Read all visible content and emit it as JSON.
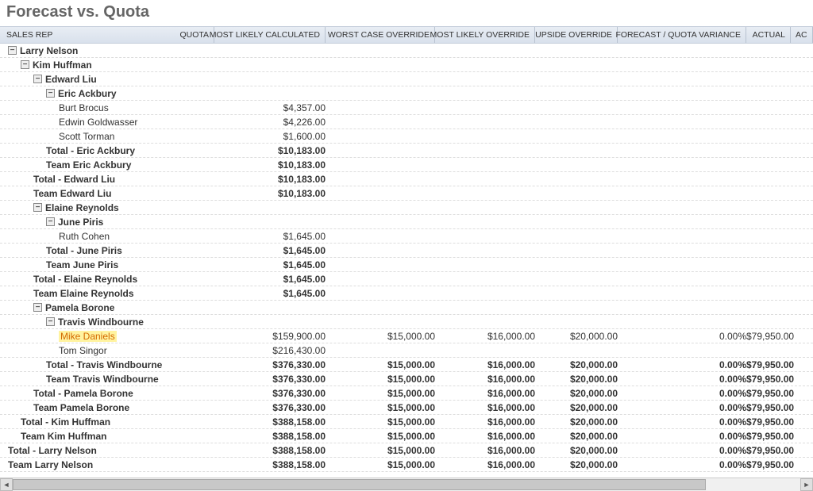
{
  "title": "Forecast vs. Quota",
  "headers": {
    "rep": "SALES REP",
    "quota": "QUOTA",
    "mlc": "MOST LIKELY CALCULATED",
    "wco": "WORST CASE OVERRIDE",
    "mlo": "MOST LIKELY OVERRIDE",
    "uo": "UPSIDE OVERRIDE",
    "fqv": "FORECAST / QUOTA VARIANCE",
    "actual": "ACTUAL",
    "last": "AC"
  },
  "rows": [
    {
      "indent": 0,
      "toggle": true,
      "bold": true,
      "label": "Larry Nelson"
    },
    {
      "indent": 1,
      "toggle": true,
      "bold": true,
      "label": "Kim Huffman"
    },
    {
      "indent": 2,
      "toggle": true,
      "bold": true,
      "label": "Edward Liu"
    },
    {
      "indent": 3,
      "toggle": true,
      "bold": true,
      "label": "Eric Ackbury"
    },
    {
      "indent": 4,
      "bold": false,
      "label": "Burt Brocus",
      "mlc": "$4,357.00"
    },
    {
      "indent": 4,
      "bold": false,
      "label": "Edwin Goldwasser",
      "mlc": "$4,226.00"
    },
    {
      "indent": 4,
      "bold": false,
      "label": "Scott Torman",
      "mlc": "$1,600.00"
    },
    {
      "indent": 3,
      "bold": true,
      "label": "Total - Eric Ackbury",
      "mlc": "$10,183.00"
    },
    {
      "indent": 3,
      "bold": true,
      "label": "Team Eric Ackbury",
      "mlc": "$10,183.00"
    },
    {
      "indent": 2,
      "bold": true,
      "label": "Total - Edward Liu",
      "mlc": "$10,183.00"
    },
    {
      "indent": 2,
      "bold": true,
      "label": "Team Edward Liu",
      "mlc": "$10,183.00"
    },
    {
      "indent": 2,
      "toggle": true,
      "bold": true,
      "label": "Elaine Reynolds"
    },
    {
      "indent": 3,
      "toggle": true,
      "bold": true,
      "label": "June Piris"
    },
    {
      "indent": 4,
      "bold": false,
      "label": "Ruth Cohen",
      "mlc": "$1,645.00"
    },
    {
      "indent": 3,
      "bold": true,
      "label": "Total - June Piris",
      "mlc": "$1,645.00"
    },
    {
      "indent": 3,
      "bold": true,
      "label": "Team June Piris",
      "mlc": "$1,645.00"
    },
    {
      "indent": 2,
      "bold": true,
      "label": "Total - Elaine Reynolds",
      "mlc": "$1,645.00"
    },
    {
      "indent": 2,
      "bold": true,
      "label": "Team Elaine Reynolds",
      "mlc": "$1,645.00"
    },
    {
      "indent": 2,
      "toggle": true,
      "bold": true,
      "label": "Pamela Borone"
    },
    {
      "indent": 3,
      "toggle": true,
      "bold": true,
      "label": "Travis Windbourne"
    },
    {
      "indent": 4,
      "bold": false,
      "highlight": true,
      "label": "Mike Daniels",
      "mlc": "$159,900.00",
      "wco": "$15,000.00",
      "mlo": "$16,000.00",
      "uo": "$20,000.00",
      "fqv": "0.00%",
      "act": "$79,950.00"
    },
    {
      "indent": 4,
      "bold": false,
      "label": "Tom Singor",
      "mlc": "$216,430.00"
    },
    {
      "indent": 3,
      "bold": true,
      "label": "Total - Travis Windbourne",
      "mlc": "$376,330.00",
      "wco": "$15,000.00",
      "mlo": "$16,000.00",
      "uo": "$20,000.00",
      "fqv": "0.00%",
      "act": "$79,950.00"
    },
    {
      "indent": 3,
      "bold": true,
      "label": "Team Travis Windbourne",
      "mlc": "$376,330.00",
      "wco": "$15,000.00",
      "mlo": "$16,000.00",
      "uo": "$20,000.00",
      "fqv": "0.00%",
      "act": "$79,950.00"
    },
    {
      "indent": 2,
      "bold": true,
      "label": "Total - Pamela Borone",
      "mlc": "$376,330.00",
      "wco": "$15,000.00",
      "mlo": "$16,000.00",
      "uo": "$20,000.00",
      "fqv": "0.00%",
      "act": "$79,950.00"
    },
    {
      "indent": 2,
      "bold": true,
      "label": "Team Pamela Borone",
      "mlc": "$376,330.00",
      "wco": "$15,000.00",
      "mlo": "$16,000.00",
      "uo": "$20,000.00",
      "fqv": "0.00%",
      "act": "$79,950.00"
    },
    {
      "indent": 1,
      "bold": true,
      "label": "Total - Kim Huffman",
      "mlc": "$388,158.00",
      "wco": "$15,000.00",
      "mlo": "$16,000.00",
      "uo": "$20,000.00",
      "fqv": "0.00%",
      "act": "$79,950.00"
    },
    {
      "indent": 1,
      "bold": true,
      "label": "Team Kim Huffman",
      "mlc": "$388,158.00",
      "wco": "$15,000.00",
      "mlo": "$16,000.00",
      "uo": "$20,000.00",
      "fqv": "0.00%",
      "act": "$79,950.00"
    },
    {
      "indent": 0,
      "bold": true,
      "label": "Total - Larry Nelson",
      "mlc": "$388,158.00",
      "wco": "$15,000.00",
      "mlo": "$16,000.00",
      "uo": "$20,000.00",
      "fqv": "0.00%",
      "act": "$79,950.00"
    },
    {
      "indent": 0,
      "bold": true,
      "label": "Team Larry Nelson",
      "mlc": "$388,158.00",
      "wco": "$15,000.00",
      "mlo": "$16,000.00",
      "uo": "$20,000.00",
      "fqv": "0.00%",
      "act": "$79,950.00"
    }
  ]
}
